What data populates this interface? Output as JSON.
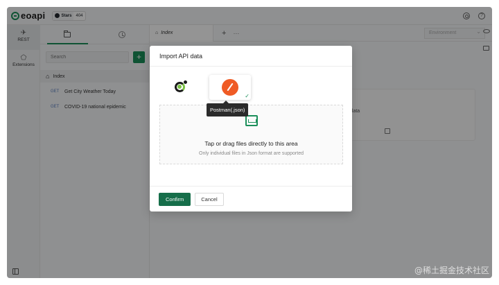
{
  "app": {
    "logo_text": "eoapi",
    "github": {
      "label": "Stars",
      "count": "404"
    }
  },
  "rail": {
    "items": [
      {
        "label": "REST",
        "icon": "rocket-icon"
      },
      {
        "label": "Extensions",
        "icon": "puzzle-icon"
      }
    ]
  },
  "sidebar": {
    "search_placeholder": "Search",
    "add_label": "+",
    "root_label": "Index",
    "apis": [
      {
        "method": "GET",
        "name": "Get City Weather Today"
      },
      {
        "method": "GET",
        "name": "COVID-19 national epidemic"
      }
    ]
  },
  "main": {
    "tab_label": "Index",
    "new_tab": "+",
    "more": "···",
    "environment_placeholder": "Environment",
    "bg_card_text": "PI data"
  },
  "modal": {
    "title": "Import API data",
    "tooltip": "Postman(.json)",
    "drop_title": "Tap or drag files directly to this area",
    "drop_hint": "Only individual files in Json format are supported",
    "confirm": "Confirm",
    "cancel": "Cancel"
  },
  "watermark": "@稀土掘金技术社区",
  "colors": {
    "accent": "#1b8f5a",
    "confirm": "#166e4a",
    "postman": "#ef5b25"
  }
}
